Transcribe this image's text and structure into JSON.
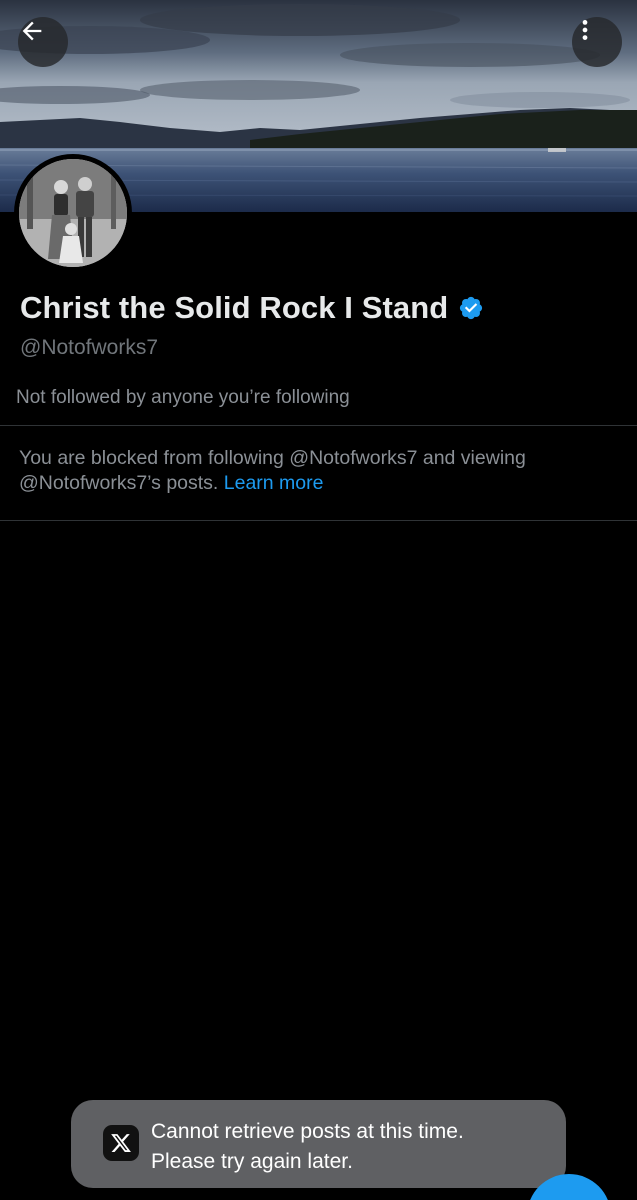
{
  "profile": {
    "display_name": "Christ the Solid Rock I Stand",
    "handle": "@Notofworks7",
    "followed_by_text": "Not followed by anyone you’re following",
    "blocked_message": "You are blocked from following @Notofworks7 and viewing @Notofworks7’s posts.",
    "learn_more_label": "Learn more",
    "verified": true
  },
  "header": {
    "back_icon": "arrow-left-icon",
    "more_icon": "more-vertical-icon"
  },
  "toast": {
    "line1": "Cannot retrieve posts at this time.",
    "line2": "Please try again later.",
    "logo": "X"
  },
  "colors": {
    "background": "#000000",
    "accent": "#1d9bf0",
    "primary_text": "#e7e9ea",
    "secondary_text": "#71767b",
    "divider": "#2f3336",
    "toast_bg": "#5f6063"
  }
}
